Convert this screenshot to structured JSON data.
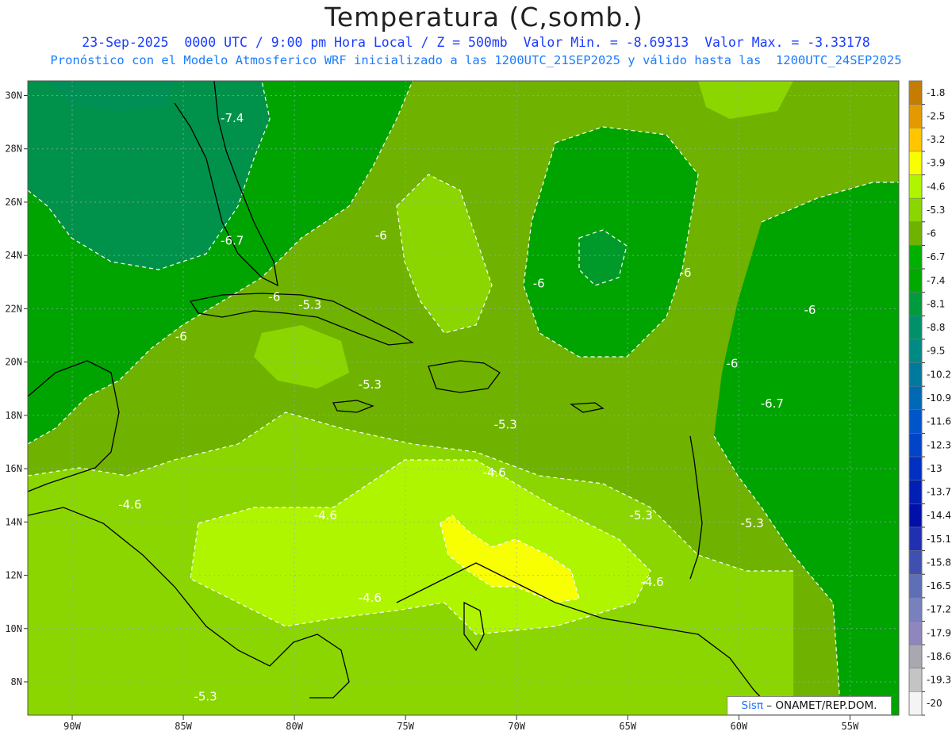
{
  "header": {
    "title": "Temperatura (C,somb.)",
    "line1": "23-Sep-2025  0000 UTC / 9:00 pm Hora Local / Z = 500mb  Valor Min. = -8.69313  Valor Max. = -3.33178",
    "line2": "Pronóstico con el Modelo Atmosferico WRF inicializado a las 1200UTC_21SEP2025 y válido hasta las  1200UTC_24SEP2025"
  },
  "map": {
    "lon_labels": [
      "90W",
      "85W",
      "80W",
      "75W",
      "70W",
      "65W",
      "60W",
      "55W"
    ],
    "lat_labels": [
      "30N",
      "28N",
      "26N",
      "24N",
      "22N",
      "20N",
      "18N",
      "16N",
      "14N",
      "12N",
      "10N",
      "8N"
    ],
    "contour_labels": [
      {
        "text": "-7.4",
        "lon": -82.8,
        "lat": 29.0
      },
      {
        "text": "-6.7",
        "lon": -82.8,
        "lat": 24.4
      },
      {
        "text": "-6",
        "lon": -80.9,
        "lat": 22.3
      },
      {
        "text": "-5.3",
        "lon": -79.3,
        "lat": 22.0
      },
      {
        "text": "-6",
        "lon": -85.1,
        "lat": 20.8
      },
      {
        "text": "-6",
        "lon": -76.1,
        "lat": 24.6
      },
      {
        "text": "-6",
        "lon": -69.0,
        "lat": 22.8
      },
      {
        "text": "-6",
        "lon": -62.4,
        "lat": 23.2
      },
      {
        "text": "-6",
        "lon": -60.3,
        "lat": 19.8
      },
      {
        "text": "-6",
        "lon": -56.8,
        "lat": 21.8
      },
      {
        "text": "-6.7",
        "lon": -58.5,
        "lat": 18.3
      },
      {
        "text": "-5.3",
        "lon": -76.6,
        "lat": 19.0
      },
      {
        "text": "-5.3",
        "lon": -70.5,
        "lat": 17.5
      },
      {
        "text": "-4.6",
        "lon": -71.0,
        "lat": 15.7
      },
      {
        "text": "-4.6",
        "lon": -87.4,
        "lat": 14.5
      },
      {
        "text": "-4.6",
        "lon": -78.6,
        "lat": 14.1
      },
      {
        "text": "-4.6",
        "lon": -76.6,
        "lat": 11.0
      },
      {
        "text": "-5.3",
        "lon": -64.4,
        "lat": 14.1
      },
      {
        "text": "-5.3",
        "lon": -59.4,
        "lat": 13.8
      },
      {
        "text": "-4.6",
        "lon": -63.9,
        "lat": 11.6
      },
      {
        "text": "-5.3",
        "lon": -84.0,
        "lat": 7.3
      }
    ],
    "credit_sis": "Sisπ",
    "credit_rest": "– ONAMET/REP.DOM."
  },
  "colorbar": {
    "labels": [
      "-1.8",
      "-2.5",
      "-3.2",
      "-3.9",
      "-4.6",
      "-5.3",
      "-6",
      "-6.7",
      "-7.4",
      "-8.1",
      "-8.8",
      "-9.5",
      "-10.2",
      "-10.9",
      "-11.6",
      "-12.3",
      "-13",
      "-13.7",
      "-14.4",
      "-15.1",
      "-15.8",
      "-16.5",
      "-17.2",
      "-17.9",
      "-18.6",
      "-19.3",
      "-20"
    ],
    "colors": [
      "#c47d00",
      "#e39a00",
      "#ffc600",
      "#f7ff00",
      "#b0f500",
      "#8bd600",
      "#6fb300",
      "#00b000",
      "#00a800",
      "#009b3c",
      "#00916b",
      "#008a86",
      "#007a9c",
      "#0069b5",
      "#0055c8",
      "#0044c8",
      "#0030c0",
      "#001fb5",
      "#0010a8",
      "#2030b0",
      "#4050b0",
      "#5f6fb5",
      "#7980be",
      "#8f86be",
      "#a8a8b0",
      "#c4c4c4",
      "#f4f4f4"
    ]
  },
  "colors": {
    "background": "#ffffff",
    "title": "#222222",
    "line1": "#1a3cff",
    "line2": "#1a7dff",
    "contour": "#ffffff",
    "coast": "#000000"
  }
}
